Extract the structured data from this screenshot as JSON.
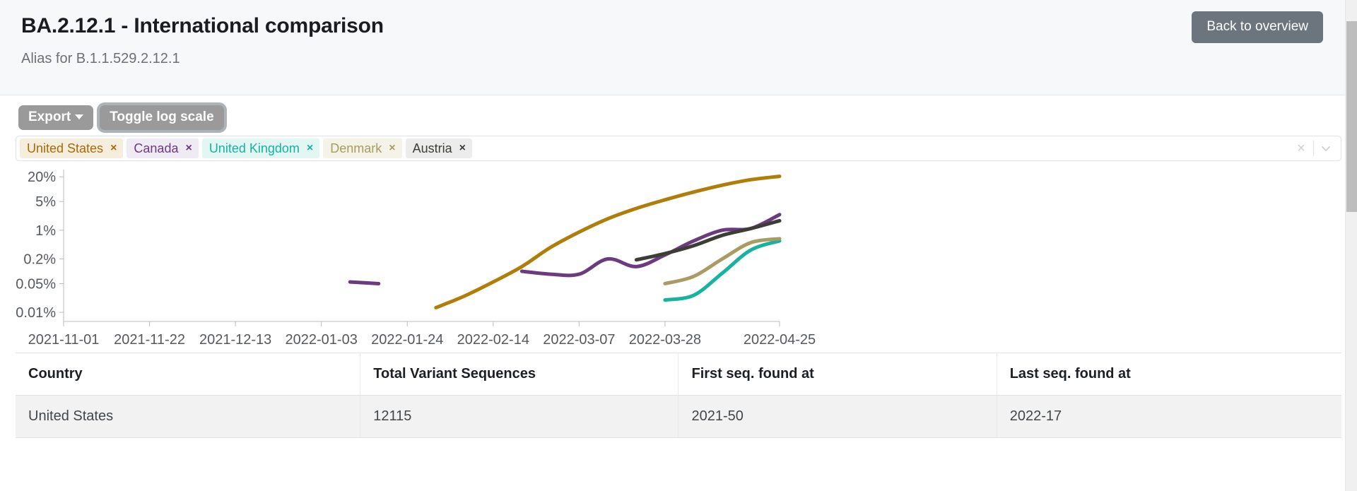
{
  "header": {
    "title": "BA.2.12.1 - International comparison",
    "subtitle": "Alias for B.1.1.529.2.12.1",
    "back_button": "Back to overview"
  },
  "toolbar": {
    "export_label": "Export",
    "export_caret": "chevron-down-icon",
    "toggle_log_scale_label": "Toggle log scale"
  },
  "country_select": {
    "tags": [
      {
        "label": "United States",
        "remove": "×",
        "text_color": "#a9690a",
        "bg_color": "#f6eedd"
      },
      {
        "label": "Canada",
        "remove": "×",
        "text_color": "#6b3a7f",
        "bg_color": "#f0eaf4"
      },
      {
        "label": "United Kingdom",
        "remove": "×",
        "text_color": "#17b2a0",
        "bg_color": "#e2f6f3"
      },
      {
        "label": "Denmark",
        "remove": "×",
        "text_color": "#a89b63",
        "bg_color": "#f5f2e7"
      },
      {
        "label": "Austria",
        "remove": "×",
        "text_color": "#3d3d35",
        "bg_color": "#ececec"
      }
    ],
    "clear_all": "×",
    "dropdown_toggle": "chevron-down-icon"
  },
  "chart_data": {
    "type": "line",
    "title": "",
    "xlabel": "",
    "ylabel": "",
    "y_scale": "log",
    "y_tick_labels": [
      "20%",
      "5%",
      "1%",
      "0.2%",
      "0.05%",
      "0.01%"
    ],
    "y_tick_values": [
      20,
      5,
      1,
      0.2,
      0.05,
      0.01
    ],
    "ylim": [
      0.006,
      30
    ],
    "x_tick_labels": [
      "2021-11-01",
      "2021-11-22",
      "2021-12-13",
      "2022-01-03",
      "2022-01-24",
      "2022-02-14",
      "2022-03-07",
      "2022-03-28",
      "2022-04-25"
    ],
    "grid": false,
    "legend": "tags-above-chart",
    "series": [
      {
        "name": "United States",
        "color": "#b07d08",
        "x": [
          "2022-01-31",
          "2022-02-07",
          "2022-02-14",
          "2022-02-21",
          "2022-02-28",
          "2022-03-07",
          "2022-03-14",
          "2022-03-21",
          "2022-03-28",
          "2022-04-04",
          "2022-04-11",
          "2022-04-18",
          "2022-04-25"
        ],
        "values": [
          0.013,
          0.025,
          0.055,
          0.13,
          0.38,
          0.9,
          1.9,
          3.4,
          5.5,
          8.5,
          12.5,
          17.0,
          20.5
        ]
      },
      {
        "name": "Canada",
        "color": "#6b3a7f",
        "x": [
          "2022-01-10",
          "2022-01-17",
          "2022-02-21",
          "2022-02-28",
          "2022-03-07",
          "2022-03-14",
          "2022-03-21",
          "2022-03-28",
          "2022-04-04",
          "2022-04-11",
          "2022-04-18",
          "2022-04-25"
        ],
        "values": [
          0.055,
          0.05,
          0.1,
          0.085,
          0.085,
          0.2,
          0.13,
          0.25,
          0.55,
          1.0,
          1.1,
          2.4
        ]
      },
      {
        "name": "United Kingdom",
        "color": "#17b2a0",
        "x": [
          "2022-03-28",
          "2022-04-04",
          "2022-04-11",
          "2022-04-18",
          "2022-04-25"
        ],
        "values": [
          0.02,
          0.026,
          0.09,
          0.33,
          0.55
        ]
      },
      {
        "name": "Denmark",
        "color": "#a89b63",
        "x": [
          "2022-03-28",
          "2022-04-04",
          "2022-04-11",
          "2022-04-18",
          "2022-04-25"
        ],
        "values": [
          0.05,
          0.075,
          0.2,
          0.5,
          0.62
        ]
      },
      {
        "name": "Austria",
        "color": "#3d3d35",
        "x": [
          "2022-03-21",
          "2022-03-28",
          "2022-04-04",
          "2022-04-11",
          "2022-04-18",
          "2022-04-25"
        ],
        "values": [
          0.19,
          0.27,
          0.42,
          0.75,
          1.1,
          1.7
        ]
      }
    ]
  },
  "table": {
    "columns": [
      "Country",
      "Total Variant Sequences",
      "First seq. found at",
      "Last seq. found at"
    ],
    "rows": [
      {
        "country": "United States",
        "total_variant_sequences": "12115",
        "first_seq_found_at": "2021-50",
        "last_seq_found_at": "2022-17"
      }
    ]
  }
}
